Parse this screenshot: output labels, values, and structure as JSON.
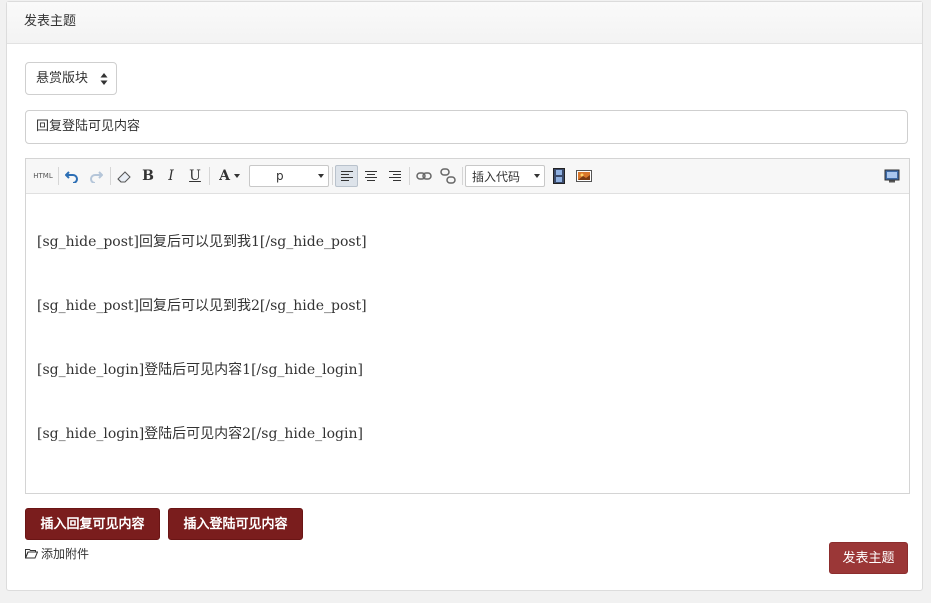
{
  "panel": {
    "title": "发表主题"
  },
  "form": {
    "category_select": "悬赏版块",
    "title_value": "回复登陆可见内容"
  },
  "toolbar": {
    "html_label": "HTML",
    "bold_label": "B",
    "italic_label": "I",
    "underline_label": "U",
    "fontcolor_label": "A",
    "format_select": "p",
    "insert_code_select": "插入代码"
  },
  "editor": {
    "lines": [
      "[sg_hide_post]回复后可以见到我1[/sg_hide_post]",
      "[sg_hide_post]回复后可以见到我2[/sg_hide_post]",
      "[sg_hide_login]登陆后可见内容1[/sg_hide_login]",
      "[sg_hide_login]登陆后可见内容2[/sg_hide_login]"
    ]
  },
  "actions": {
    "insert_reply_label": "插入回复可见内容",
    "insert_login_label": "插入登陆可见内容",
    "attach_label": "添加附件",
    "submit_label": "发表主题"
  },
  "colors": {
    "dark_button": "#7a1d1d",
    "submit_button": "#9b3737"
  }
}
